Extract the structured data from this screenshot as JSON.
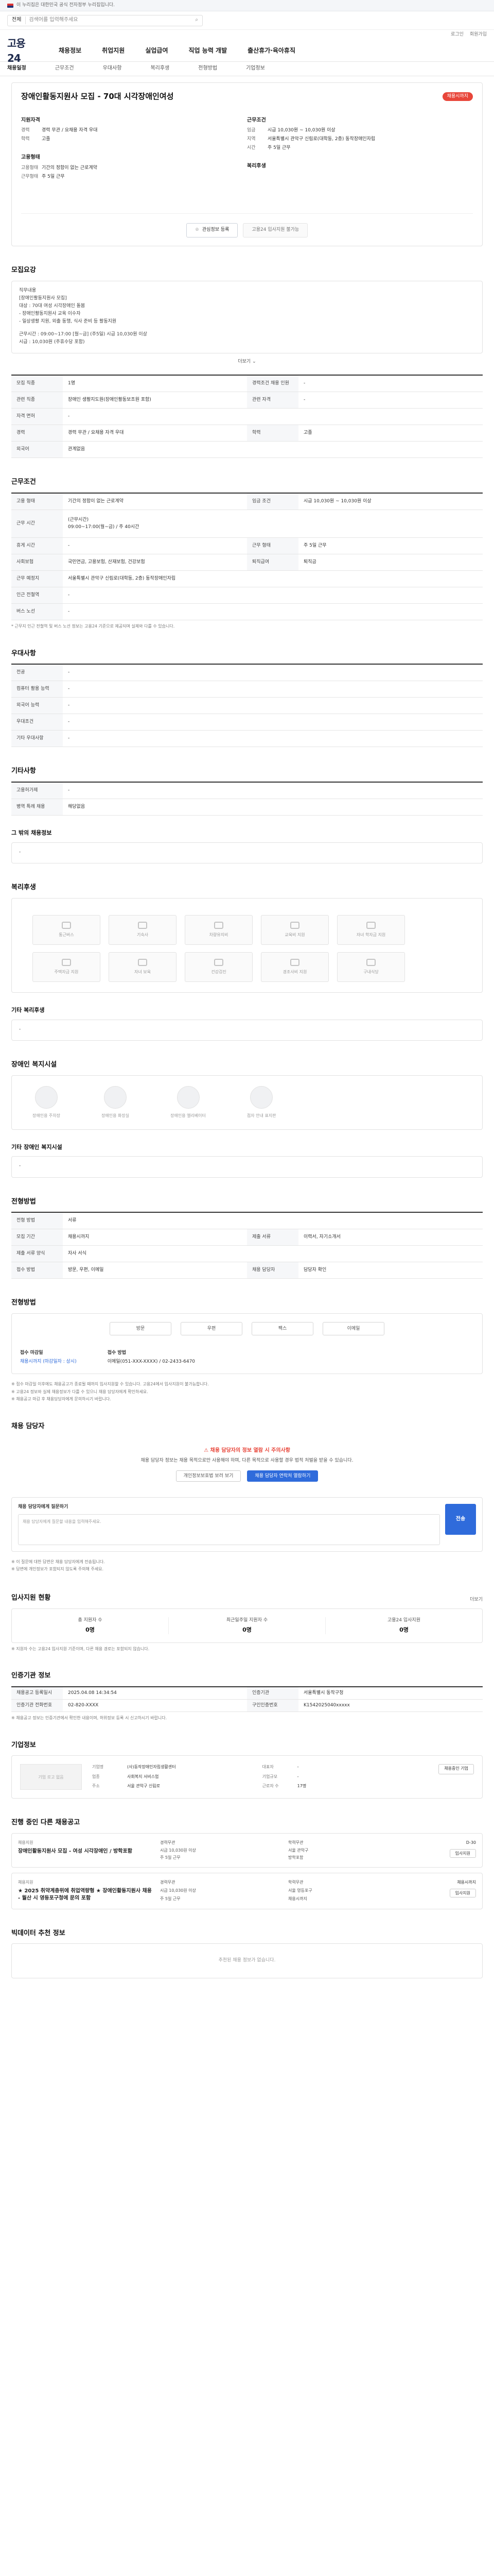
{
  "topnotice": "이 누리집은 대한민국 공식 전자정부 누리집입니다.",
  "search": {
    "category": "전체",
    "placeholder": "검색어를 입력해주세요"
  },
  "util": [
    "로그인",
    "회원가입"
  ],
  "logo": "고용24",
  "gnb": [
    "채용정보",
    "취업지원",
    "실업급여",
    "직업 능력 개발",
    "출산휴가·육아휴직"
  ],
  "lnb": [
    "채용일정",
    "근무조건",
    "우대사항",
    "복리후생",
    "전형방법",
    "기업정보"
  ],
  "job": {
    "title": "장애인활동지원사 모집 - 70대 시각장애인여성",
    "badge": "채용시까지",
    "applicant_head": "지원자격",
    "career_k": "경력",
    "career_v": "경력 무관 / 요채용 자격 우대",
    "edu_k": "학력",
    "edu_v": "고졸",
    "type_head": "고용형태",
    "type_k": "고용형태",
    "type_v": "기간의 정함이 없는 근로계약",
    "wage_head": "근무조건",
    "wage_k": "임금",
    "wage_v": "시급 10,030원 ~ 10,030원 이상",
    "place_k": "지역",
    "place_v": "서울특별시 관악구 신림로(대학동, 2층) 동작장애인자립",
    "time_k": "시간",
    "time_v": "주 5일 근무",
    "welfare_head": "복리후생",
    "welfare_k": "근무형태",
    "welfare_v": "주 5일 근무",
    "btn_interest": "관심정보 등록",
    "btn_apply": "고용24 입사지원 불가능"
  },
  "recruit": {
    "title": "모집요강",
    "box": [
      "직무내용",
      "[장애인활동지원사 모집]",
      "대상 : 70대 여성 시각장애인 돌봄",
      "- 장애인활동지원사 교육 이수자",
      "- 일상생활 지원, 외출 동행, 식사 준비 등 활동지원",
      "근무시간 : 09:00~17:00 [월~금] (주5일) 시급 10,030원 이상",
      "시급 : 10,030원 (주휴수당 포함)"
    ],
    "more": "더보기",
    "rows": [
      {
        "k": "모집 직종",
        "v": "1명",
        "k2": "경력조건 채용 인원",
        "v2": "-"
      },
      {
        "k": "관련 직종",
        "v": "장애인 생활지도원(장애인활동보조원 포함)",
        "k2": "관련 자격",
        "v2": "-"
      },
      {
        "k": "자격 면허",
        "v": "-",
        "k2": "",
        "v2": ""
      },
      {
        "k": "경력",
        "v": "경력 무관 / 요채용 자격 우대",
        "k2": "학력",
        "v2": "고졸"
      },
      {
        "k": "외국어",
        "v": "관계없음",
        "k2": "",
        "v2": ""
      }
    ]
  },
  "condition": {
    "title": "근무조건",
    "rows": [
      {
        "k": "고용 형태",
        "v": "기간의 정함이 없는 근로계약",
        "k2": "임금 조건",
        "v2": "시급 10,030원 ~ 10,030원 이상"
      },
      {
        "k": "근무 시간",
        "v": "(근무시간)\n09:00~17:00(월~금) / 주 40시간",
        "k2": "",
        "v2": ""
      },
      {
        "k": "휴게 시간",
        "v": "-",
        "k2": "근무 형태",
        "v2": "주 5일 근무"
      },
      {
        "k": "사회보험",
        "v": "국민연금, 고용보험, 산재보험, 건강보험",
        "k2": "퇴직급여",
        "v2": "퇴직금"
      },
      {
        "k": "근무 예정지",
        "v": "서울특별시 관악구 신림로(대학동, 2층) 동작장애인자립",
        "k2": "",
        "v2": ""
      },
      {
        "k": "인근 전철역",
        "v": "-",
        "k2": "",
        "v2": ""
      },
      {
        "k": "버스 노선",
        "v": "-",
        "k2": "",
        "v2": ""
      }
    ],
    "note": "* 근무지 인근 전철역 및 버스 노선 정보는 고용24 기준으로 제공되며 실제와 다를 수 있습니다."
  },
  "preferred": {
    "title": "우대사항",
    "rows": [
      {
        "k": "전공",
        "v": "-"
      },
      {
        "k": "컴퓨터 활용 능력",
        "v": "-"
      },
      {
        "k": "외국어 능력",
        "v": "-"
      },
      {
        "k": "우대조건",
        "v": "-"
      },
      {
        "k": "기타 우대사항",
        "v": "-"
      }
    ]
  },
  "etc": {
    "title": "기타사항",
    "rows": [
      {
        "k": "고용허가제",
        "v": "-"
      },
      {
        "k": "병역 특례 채용",
        "v": "해당없음"
      }
    ],
    "sub_title": "그 밖의 채용정보",
    "sub_v": "-"
  },
  "welfare": {
    "title": "복리후생",
    "icons": [
      "통근버스",
      "기숙사",
      "차량유지비",
      "교육비 지원",
      "자녀 학자금 지원",
      "주택자금 지원",
      "자녀 보육",
      "건강검진",
      "경조사비 지원",
      "구내식당"
    ],
    "etc_title": "기타 복리후생",
    "etc_v": "-"
  },
  "disabled": {
    "title": "장애인 복지시설",
    "items": [
      "장애인용 주차장",
      "장애인용 화장실",
      "장애인용 엘리베이터",
      "점자 안내 표지판"
    ],
    "etc_title": "기타 장애인 복지시설",
    "etc_v": "-"
  },
  "process": {
    "title": "전형방법",
    "rows": [
      {
        "k": "전형 방법",
        "v": "서류",
        "k2": "",
        "v2": ""
      },
      {
        "k": "모집 기간",
        "v": "채용시까지",
        "k2": "제출 서류",
        "v2": "이력서, 자기소개서"
      },
      {
        "k": "제출 서류 양식",
        "v": "자사 서식",
        "k2": "",
        "v2": ""
      },
      {
        "k": "접수 방법",
        "v": "방문, 우편, 이메일",
        "k2": "채용 담당자",
        "v2": "담당자 확인"
      }
    ]
  },
  "apply": {
    "title": "전형방법",
    "btns": [
      "방문",
      "우편",
      "팩스",
      "이메일"
    ],
    "info1_k": "접수 마감일",
    "info1_v": "채용시까지 (마감일자 : 상시)",
    "info2_k": "접수 방법",
    "info2_v": "이메일(051-XXX-XXXX) / 02-2433-6470",
    "notes": [
      "※ 접수 마감일 이후에도 채용공고가 종료될 때까지 입사지원할 수 있습니다. 고용24에서 입사지원이 불가능합니다.",
      "※ 고용24 정보와 실제 채용정보가 다를 수 있으니 채용 담당자에게 확인하세요.",
      "※ 채용공고 마감 후 채용담당자에게 문의하시기 바랍니다."
    ]
  },
  "manager": {
    "title": "채용 담당자",
    "notice": "채용 담당자의 정보 열람 시 주의사항",
    "desc": "채용 담당자 정보는 채용 목적으로만 사용해야 하며, 다른 목적으로 사용할 경우 법적 처벌을 받을 수 있습니다.",
    "btn1": "개인정보보호법 보러 보기",
    "btn2": "채용 담당자 연락처 열람하기",
    "qna_title": "채용 담당자에게 질문하기",
    "qna_placeholder": "채용 담당자에게 질문할 내용을 입력해주세요.",
    "qna_send": "전송",
    "qna_notes": [
      "※ 이 질문에 대한 답변은 채용 담당자에게 전송됩니다.",
      "※ 답변에 개인정보가 포함되지 않도록 주의해 주세요."
    ]
  },
  "stats": {
    "title": "입사지원 현황",
    "more": "더보기",
    "items": [
      {
        "k": "총 지원자 수",
        "v": "0명"
      },
      {
        "k": "최근일주일 지원자 수",
        "v": "0명"
      },
      {
        "k": "고용24 입사지원",
        "v": "0명"
      }
    ],
    "note": "※ 지원자 수는 고용24 입사지원 기준이며, 다른 채용 경로는 포함되지 않습니다."
  },
  "info": {
    "title": "인증기관 정보",
    "rows": [
      {
        "k": "채용공고 등록일시",
        "v": "2025.04.08 14:34:54"
      },
      {
        "k": "인증기관",
        "v": "서울특별시 동작구청"
      },
      {
        "k": "인증기관 전화번호",
        "v": "02-820-XXXX"
      },
      {
        "k": "구인인증번호",
        "v": "K1542025040xxxxx"
      }
    ],
    "note": "※ 채용공고 정보는 인증기관에서 확인한 내용이며, 허위정보 등록 시 신고하시기 바랍니다."
  },
  "company": {
    "title": "기업정보",
    "logo": "기업 로고 없음",
    "btn": "채용중인 기업",
    "fields": [
      {
        "k": "기업명",
        "v": "(사)동작장애인자립생활센터"
      },
      {
        "k": "업종",
        "v": "사회복지 서비스업"
      },
      {
        "k": "대표자",
        "v": "-"
      },
      {
        "k": "기업규모",
        "v": "-"
      },
      {
        "k": "주소",
        "v": "서울 관악구 신림로"
      },
      {
        "k": "근로자 수",
        "v": "17명"
      }
    ]
  },
  "related": {
    "title": "진행 중인 다른 채용공고",
    "cards": [
      {
        "org": "채용지원",
        "t": "장애인활동지원사 모집 - 여성 시각장애인 / 방학포함",
        "m": [
          "경력무관",
          "학력무관",
          "시급 10,030원 이상",
          "서울 관악구",
          "주 5일 근무",
          "방학포함"
        ],
        "d": "D-30"
      },
      {
        "org": "채용지원",
        "t": "★ 2025 취약계층위에 취업역량형 ★ 장애인활동지원사 채용 - 월산 시 영등포구청에 문의 포함",
        "m": [
          "경력무관",
          "학력무관",
          "시급 10,030원 이상",
          "서울 영등포구",
          "주 5일 근무",
          "채용시까지"
        ],
        "d": "채용시까지"
      }
    ],
    "apply_btn": "입사지원"
  },
  "recommend": {
    "title": "빅데이터 추천 정보",
    "empty": "추천된 채용 정보가 없습니다."
  }
}
